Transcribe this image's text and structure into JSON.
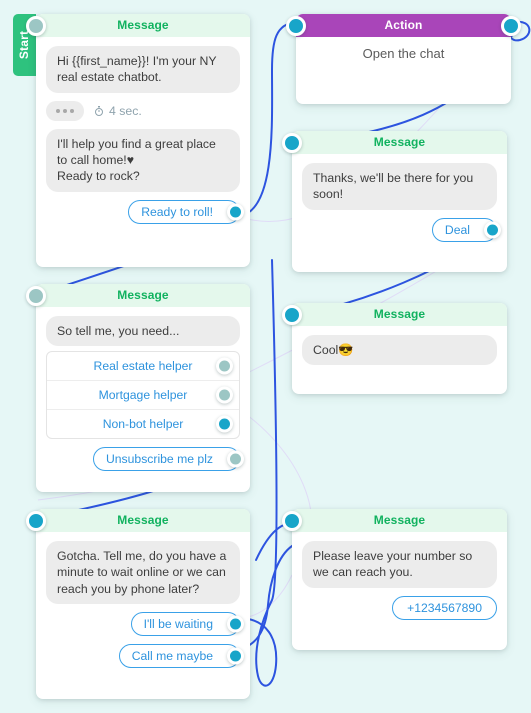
{
  "canvas": {
    "background_color": "#e6f7f6",
    "wire_color": "#2d54e0",
    "ghost_wire_color": "#dcd8f5"
  },
  "start_tab": {
    "label": "Start"
  },
  "palette": {
    "message_header_bg": "#e4f8ec",
    "message_header_text": "#11b25f",
    "action_header_bg": "#a945b9",
    "action_header_text": "#ffffff",
    "bubble_bg": "#ececec",
    "reply_border": "#3aa1e8",
    "reply_text": "#2e93dd",
    "dot_active": "#18a5c9",
    "dot_inactive": "#9cc6c4"
  },
  "nodes": [
    {
      "id": "welcome",
      "type": "Message",
      "title": "Message",
      "bubbles": [
        "Hi {{first_name}}! I'm your NY real estate chatbot.",
        "I'll help you find a great place to call home!♥\nReady to rock?"
      ],
      "delay": {
        "icon": "stopwatch-icon",
        "label": "4 sec."
      },
      "buttons": [
        {
          "label": "Ready to roll!",
          "dot": "active"
        }
      ],
      "input_dot": "inactive"
    },
    {
      "id": "open-chat",
      "type": "Action",
      "title": "Action",
      "text": "Open the chat",
      "input_dot": "active",
      "output_dot": "active"
    },
    {
      "id": "thanks",
      "type": "Message",
      "title": "Message",
      "bubbles": [
        "Thanks, we'll be there for you soon!"
      ],
      "buttons": [
        {
          "label": "Deal",
          "dot": "active"
        }
      ],
      "input_dot": "active"
    },
    {
      "id": "needs",
      "type": "Message",
      "title": "Message",
      "bubbles": [
        "So tell me, you need..."
      ],
      "options": [
        {
          "label": "Real estate helper",
          "dot": "inactive"
        },
        {
          "label": "Mortgage helper",
          "dot": "inactive"
        },
        {
          "label": "Non-bot helper",
          "dot": "active"
        }
      ],
      "buttons": [
        {
          "label": "Unsubscribe me plz",
          "dot": "inactive"
        }
      ],
      "input_dot": "inactive"
    },
    {
      "id": "cool",
      "type": "Message",
      "title": "Message",
      "bubbles": [
        "Cool😎"
      ],
      "input_dot": "active"
    },
    {
      "id": "gotcha",
      "type": "Message",
      "title": "Message",
      "bubbles": [
        "Gotcha. Tell me, do you have a minute to wait online or we can reach you by phone later?"
      ],
      "buttons": [
        {
          "label": "I'll be waiting",
          "dot": "active"
        },
        {
          "label": "Call me maybe",
          "dot": "active"
        }
      ],
      "input_dot": "active"
    },
    {
      "id": "phone",
      "type": "Message",
      "title": "Message",
      "bubbles": [
        "Please leave your number so we can reach you."
      ],
      "buttons": [
        {
          "label": "+1234567890",
          "dot": "none"
        }
      ],
      "input_dot": "active"
    }
  ]
}
